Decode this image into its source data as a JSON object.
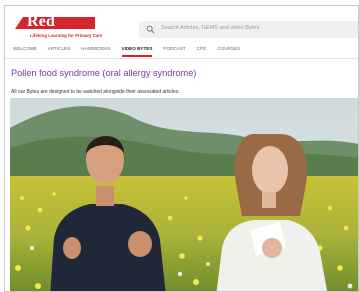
{
  "header": {
    "logo": {
      "name": "Red Whale",
      "tagline": "Lifelong Learning for Primary Care"
    },
    "search": {
      "placeholder": "Search Articles, GEMS and video Bytes",
      "icon": "search-icon"
    }
  },
  "nav": {
    "items": [
      {
        "label": "WELCOME",
        "active": false
      },
      {
        "label": "ARTICLES",
        "active": false
      },
      {
        "label": "HANDBOOKS",
        "active": false
      },
      {
        "label": "VIDEO BYTES",
        "active": true
      },
      {
        "label": "PODCAST",
        "active": false
      },
      {
        "label": "CPD",
        "active": false
      },
      {
        "label": "COURSES",
        "active": false
      }
    ]
  },
  "page": {
    "title": "Pollen food syndrome (oral allergy syndrome)",
    "intro": "All our Bytes are designed to be watched alongside their associated articles."
  },
  "colors": {
    "brand_red": "#d3262c",
    "title_purple": "#7b3aa0",
    "active_underline": "#d3262c"
  }
}
